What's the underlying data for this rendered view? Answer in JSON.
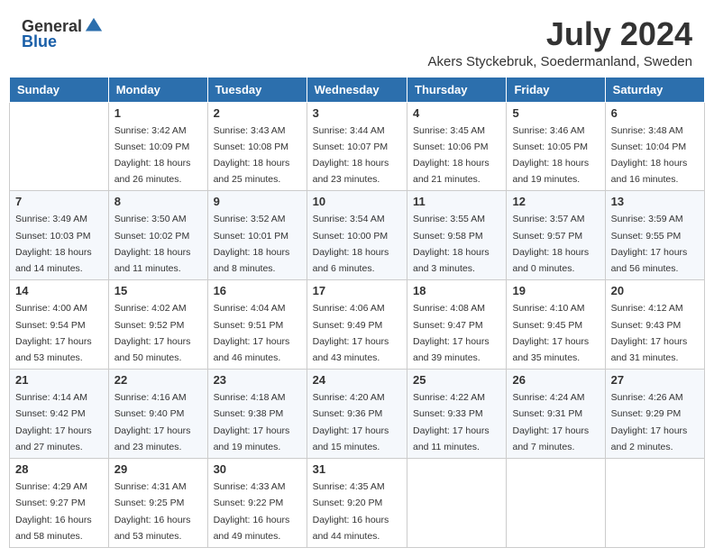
{
  "logo": {
    "general": "General",
    "blue": "Blue"
  },
  "title": {
    "month": "July 2024",
    "location": "Akers Styckebruk, Soedermanland, Sweden"
  },
  "weekdays": [
    "Sunday",
    "Monday",
    "Tuesday",
    "Wednesday",
    "Thursday",
    "Friday",
    "Saturday"
  ],
  "weeks": [
    [
      {
        "day": "",
        "sunrise": "",
        "sunset": "",
        "daylight": ""
      },
      {
        "day": "1",
        "sunrise": "Sunrise: 3:42 AM",
        "sunset": "Sunset: 10:09 PM",
        "daylight": "Daylight: 18 hours and 26 minutes."
      },
      {
        "day": "2",
        "sunrise": "Sunrise: 3:43 AM",
        "sunset": "Sunset: 10:08 PM",
        "daylight": "Daylight: 18 hours and 25 minutes."
      },
      {
        "day": "3",
        "sunrise": "Sunrise: 3:44 AM",
        "sunset": "Sunset: 10:07 PM",
        "daylight": "Daylight: 18 hours and 23 minutes."
      },
      {
        "day": "4",
        "sunrise": "Sunrise: 3:45 AM",
        "sunset": "Sunset: 10:06 PM",
        "daylight": "Daylight: 18 hours and 21 minutes."
      },
      {
        "day": "5",
        "sunrise": "Sunrise: 3:46 AM",
        "sunset": "Sunset: 10:05 PM",
        "daylight": "Daylight: 18 hours and 19 minutes."
      },
      {
        "day": "6",
        "sunrise": "Sunrise: 3:48 AM",
        "sunset": "Sunset: 10:04 PM",
        "daylight": "Daylight: 18 hours and 16 minutes."
      }
    ],
    [
      {
        "day": "7",
        "sunrise": "Sunrise: 3:49 AM",
        "sunset": "Sunset: 10:03 PM",
        "daylight": "Daylight: 18 hours and 14 minutes."
      },
      {
        "day": "8",
        "sunrise": "Sunrise: 3:50 AM",
        "sunset": "Sunset: 10:02 PM",
        "daylight": "Daylight: 18 hours and 11 minutes."
      },
      {
        "day": "9",
        "sunrise": "Sunrise: 3:52 AM",
        "sunset": "Sunset: 10:01 PM",
        "daylight": "Daylight: 18 hours and 8 minutes."
      },
      {
        "day": "10",
        "sunrise": "Sunrise: 3:54 AM",
        "sunset": "Sunset: 10:00 PM",
        "daylight": "Daylight: 18 hours and 6 minutes."
      },
      {
        "day": "11",
        "sunrise": "Sunrise: 3:55 AM",
        "sunset": "Sunset: 9:58 PM",
        "daylight": "Daylight: 18 hours and 3 minutes."
      },
      {
        "day": "12",
        "sunrise": "Sunrise: 3:57 AM",
        "sunset": "Sunset: 9:57 PM",
        "daylight": "Daylight: 18 hours and 0 minutes."
      },
      {
        "day": "13",
        "sunrise": "Sunrise: 3:59 AM",
        "sunset": "Sunset: 9:55 PM",
        "daylight": "Daylight: 17 hours and 56 minutes."
      }
    ],
    [
      {
        "day": "14",
        "sunrise": "Sunrise: 4:00 AM",
        "sunset": "Sunset: 9:54 PM",
        "daylight": "Daylight: 17 hours and 53 minutes."
      },
      {
        "day": "15",
        "sunrise": "Sunrise: 4:02 AM",
        "sunset": "Sunset: 9:52 PM",
        "daylight": "Daylight: 17 hours and 50 minutes."
      },
      {
        "day": "16",
        "sunrise": "Sunrise: 4:04 AM",
        "sunset": "Sunset: 9:51 PM",
        "daylight": "Daylight: 17 hours and 46 minutes."
      },
      {
        "day": "17",
        "sunrise": "Sunrise: 4:06 AM",
        "sunset": "Sunset: 9:49 PM",
        "daylight": "Daylight: 17 hours and 43 minutes."
      },
      {
        "day": "18",
        "sunrise": "Sunrise: 4:08 AM",
        "sunset": "Sunset: 9:47 PM",
        "daylight": "Daylight: 17 hours and 39 minutes."
      },
      {
        "day": "19",
        "sunrise": "Sunrise: 4:10 AM",
        "sunset": "Sunset: 9:45 PM",
        "daylight": "Daylight: 17 hours and 35 minutes."
      },
      {
        "day": "20",
        "sunrise": "Sunrise: 4:12 AM",
        "sunset": "Sunset: 9:43 PM",
        "daylight": "Daylight: 17 hours and 31 minutes."
      }
    ],
    [
      {
        "day": "21",
        "sunrise": "Sunrise: 4:14 AM",
        "sunset": "Sunset: 9:42 PM",
        "daylight": "Daylight: 17 hours and 27 minutes."
      },
      {
        "day": "22",
        "sunrise": "Sunrise: 4:16 AM",
        "sunset": "Sunset: 9:40 PM",
        "daylight": "Daylight: 17 hours and 23 minutes."
      },
      {
        "day": "23",
        "sunrise": "Sunrise: 4:18 AM",
        "sunset": "Sunset: 9:38 PM",
        "daylight": "Daylight: 17 hours and 19 minutes."
      },
      {
        "day": "24",
        "sunrise": "Sunrise: 4:20 AM",
        "sunset": "Sunset: 9:36 PM",
        "daylight": "Daylight: 17 hours and 15 minutes."
      },
      {
        "day": "25",
        "sunrise": "Sunrise: 4:22 AM",
        "sunset": "Sunset: 9:33 PM",
        "daylight": "Daylight: 17 hours and 11 minutes."
      },
      {
        "day": "26",
        "sunrise": "Sunrise: 4:24 AM",
        "sunset": "Sunset: 9:31 PM",
        "daylight": "Daylight: 17 hours and 7 minutes."
      },
      {
        "day": "27",
        "sunrise": "Sunrise: 4:26 AM",
        "sunset": "Sunset: 9:29 PM",
        "daylight": "Daylight: 17 hours and 2 minutes."
      }
    ],
    [
      {
        "day": "28",
        "sunrise": "Sunrise: 4:29 AM",
        "sunset": "Sunset: 9:27 PM",
        "daylight": "Daylight: 16 hours and 58 minutes."
      },
      {
        "day": "29",
        "sunrise": "Sunrise: 4:31 AM",
        "sunset": "Sunset: 9:25 PM",
        "daylight": "Daylight: 16 hours and 53 minutes."
      },
      {
        "day": "30",
        "sunrise": "Sunrise: 4:33 AM",
        "sunset": "Sunset: 9:22 PM",
        "daylight": "Daylight: 16 hours and 49 minutes."
      },
      {
        "day": "31",
        "sunrise": "Sunrise: 4:35 AM",
        "sunset": "Sunset: 9:20 PM",
        "daylight": "Daylight: 16 hours and 44 minutes."
      },
      {
        "day": "",
        "sunrise": "",
        "sunset": "",
        "daylight": ""
      },
      {
        "day": "",
        "sunrise": "",
        "sunset": "",
        "daylight": ""
      },
      {
        "day": "",
        "sunrise": "",
        "sunset": "",
        "daylight": ""
      }
    ]
  ]
}
